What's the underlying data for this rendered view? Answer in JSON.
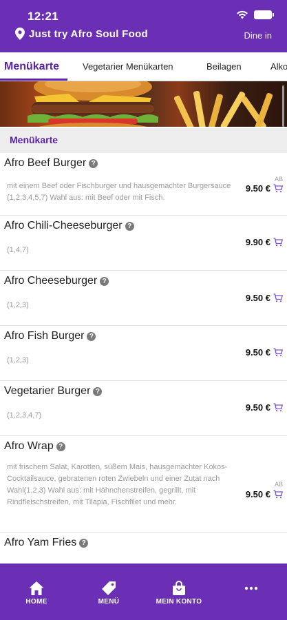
{
  "status_bar": {
    "time": "12:21"
  },
  "header": {
    "restaurant": "Just try Afro Soul Food",
    "mode": "Dine in"
  },
  "tabs": [
    {
      "label": "Menükarte",
      "active": true
    },
    {
      "label": "Vegetarier Menükarten",
      "active": false
    },
    {
      "label": "Beilagen",
      "active": false
    },
    {
      "label": "Alko",
      "active": false
    }
  ],
  "section": {
    "title": "Menükarte"
  },
  "items": [
    {
      "name": "Afro Beef Burger",
      "description": "mit einem Beef oder Fischburger und hausgemachter Burgersauce (1,2,3,4,5,7) Wahl aus: mit Beef oder mit Fisch.",
      "price": "9.50 €",
      "ab": "AB"
    },
    {
      "name": "Afro Chili-Cheeseburger",
      "description": "(1,4,7)",
      "price": "9.90 €",
      "ab": ""
    },
    {
      "name": "Afro Cheeseburger",
      "description": "(1,2,3)",
      "price": "9.50 €",
      "ab": ""
    },
    {
      "name": "Afro Fish Burger",
      "description": "(1,2,3)",
      "price": "9.50 €",
      "ab": ""
    },
    {
      "name": "Vegetarier Burger",
      "description": "(1,2,3,4,7)",
      "price": "9.50 €",
      "ab": ""
    },
    {
      "name": "Afro Wrap",
      "description": "mit frischem Salat, Karotten, süßem Mais, hausgemachter Kokos-Cocktailsauce, gebratenen roten Zwiebeln und einer Zutat nach Wahl(1,2,3) Wahl aus: mit Hähnchenstreifen, gegrillt, mit Rindfleischstreifen, mit Tilapia, Fischfilet und mehr.",
      "price": "9.50 €",
      "ab": "AB"
    },
    {
      "name": "Afro Yam Fries",
      "description": "",
      "price": "",
      "ab": ""
    }
  ],
  "bottom_nav": [
    {
      "label": "HOME",
      "icon": "home-icon"
    },
    {
      "label": "MENÜ",
      "icon": "tag-icon"
    },
    {
      "label": "MEIN KONTO",
      "icon": "shopping-bag-icon"
    },
    {
      "label": "",
      "icon": "more-icon"
    }
  ],
  "colors": {
    "brand": "#6a2fb5",
    "accent": "#5a22a8",
    "cart": "#7a4fd0"
  }
}
